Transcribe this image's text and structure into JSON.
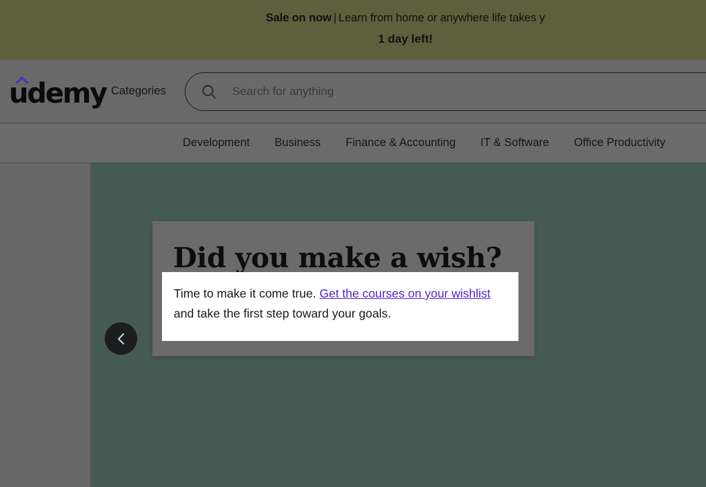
{
  "promo_banner": {
    "headline_strong": "Sale on now",
    "separator": "|",
    "headline_rest": "Learn from home or anywhere life takes y",
    "countdown": "1 day left!",
    "background_color": "#5e603d"
  },
  "header": {
    "brand_name": "udemy",
    "brand_accent_color": "#5624d0",
    "categories_label": "Categories",
    "search": {
      "placeholder": "Search for anything",
      "value": "",
      "icon": "search-icon"
    }
  },
  "category_bar": {
    "items": [
      {
        "label": "Development"
      },
      {
        "label": "Business"
      },
      {
        "label": "Finance & Accounting"
      },
      {
        "label": "IT & Software"
      },
      {
        "label": "Office Productivity"
      }
    ]
  },
  "hero": {
    "background_color": "#455a52",
    "prev_button": {
      "icon": "chevron-left-icon",
      "aria_label": "Previous"
    }
  },
  "wish_card": {
    "title": "Did you make a wish?",
    "body_prefix": "Time to make it come true. ",
    "link_text": "Get the courses on your wishlist",
    "body_suffix": " and take the first step toward your goals.",
    "link_color": "#5722d1"
  }
}
